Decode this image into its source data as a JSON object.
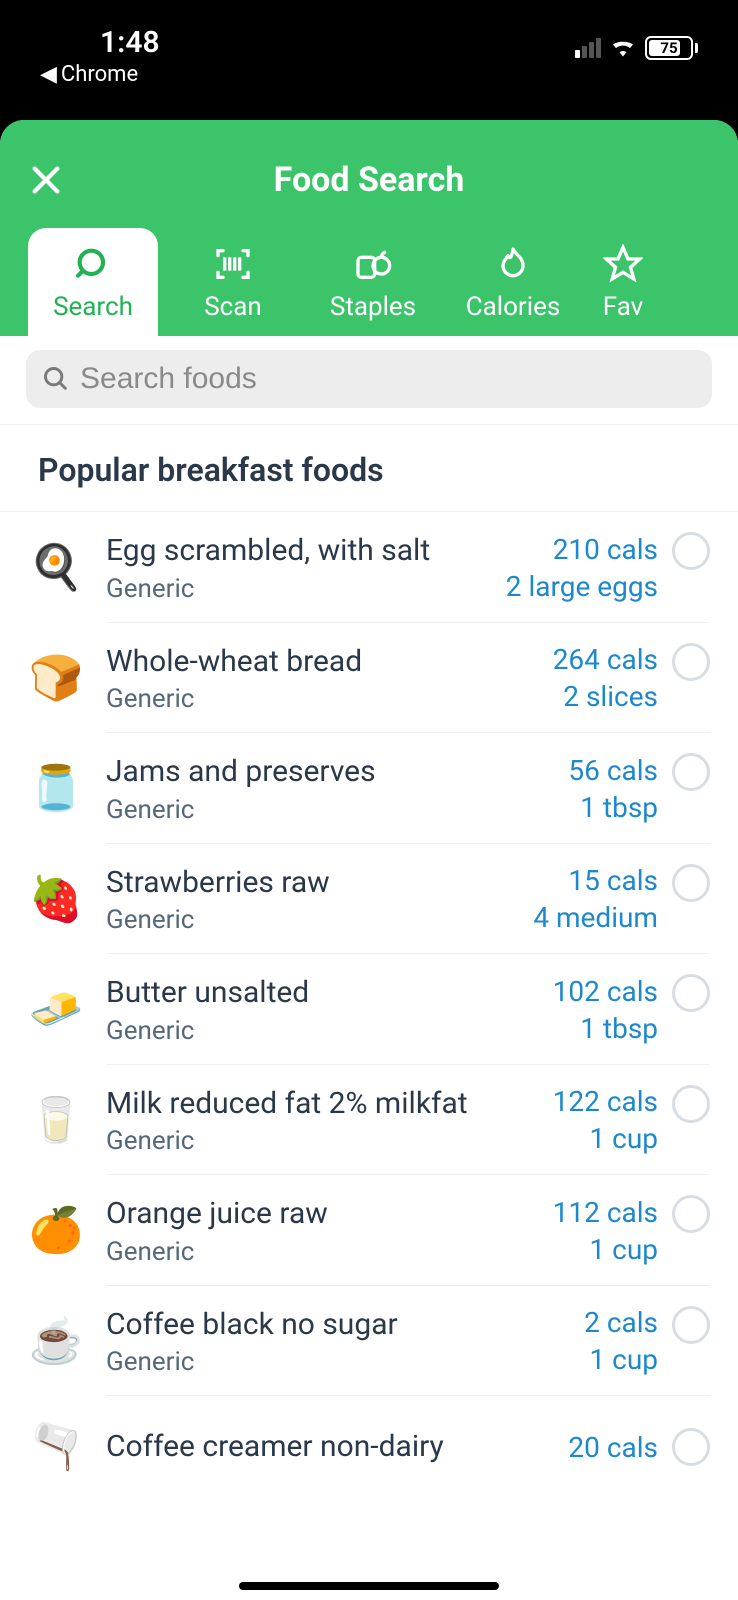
{
  "status": {
    "time": "1:48",
    "back_app": "Chrome",
    "battery_pct": "75"
  },
  "header": {
    "title": "Food Search"
  },
  "tabs": [
    {
      "id": "search",
      "label": "Search",
      "active": true
    },
    {
      "id": "scan",
      "label": "Scan"
    },
    {
      "id": "staples",
      "label": "Staples"
    },
    {
      "id": "calories",
      "label": "Calories"
    },
    {
      "id": "favorites",
      "label": "Fav"
    }
  ],
  "search": {
    "placeholder": "Search foods"
  },
  "section": {
    "title": "Popular breakfast foods"
  },
  "foods": [
    {
      "icon": "🍳",
      "name": "Egg scrambled, with salt",
      "sub": "Generic",
      "cals": "210 cals",
      "serving": "2 large eggs"
    },
    {
      "icon": "🍞",
      "name": "Whole-wheat bread",
      "sub": "Generic",
      "cals": "264 cals",
      "serving": "2 slices"
    },
    {
      "icon": "🍓",
      "name_override": "Jams and preserves",
      "icon_override": "🍯",
      "name": "Jams and preserves",
      "sub": "Generic",
      "cals": "56 cals",
      "serving": "1 tbsp",
      "icon_char": "🍓"
    },
    {
      "icon": "🍓",
      "name": "Strawberries raw",
      "sub": "Generic",
      "cals": "15 cals",
      "serving": "4 medium"
    },
    {
      "icon": "🧈",
      "name": "Butter unsalted",
      "sub": "Generic",
      "cals": "102 cals",
      "serving": "1 tbsp"
    },
    {
      "icon": "🥛",
      "name": "Milk reduced fat 2% milkfat",
      "sub": "Generic",
      "cals": "122 cals",
      "serving": "1 cup"
    },
    {
      "icon": "🍊",
      "name": "Orange juice raw",
      "sub": "Generic",
      "cals": "112 cals",
      "serving": "1 cup"
    },
    {
      "icon": "☕",
      "name": "Coffee black no sugar",
      "sub": "Generic",
      "cals": "2 cals",
      "serving": "1 cup"
    },
    {
      "icon": "🥛",
      "name": "Coffee creamer non-dairy",
      "sub": "",
      "cals": "20 cals",
      "serving": ""
    }
  ],
  "food_icons": [
    "🍳",
    "🍞",
    "🫙",
    "🍓",
    "🧈",
    "🥛",
    "🍊",
    "☕",
    "🫗"
  ]
}
